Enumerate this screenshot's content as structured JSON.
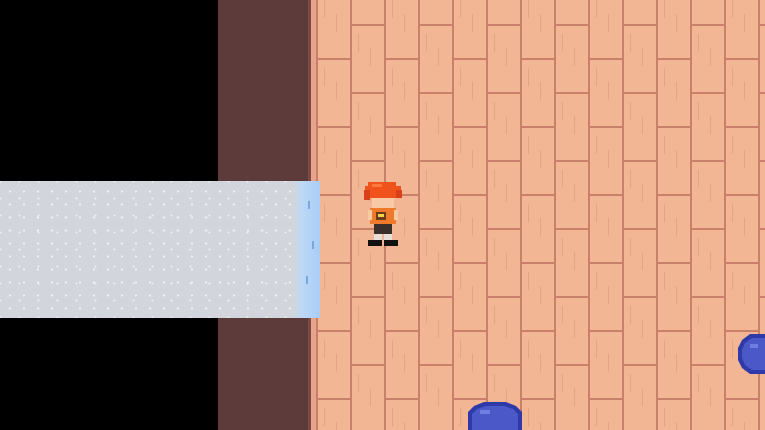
{
  "scene": {
    "type": "top-down pixel-art room",
    "colors": {
      "void": "#000000",
      "wall": "#5c3b3a",
      "floor": "#f2b694",
      "floor_line": "#c9806a",
      "ramp": "#d2d6dc",
      "ramp_edge": "#aacdf5",
      "hair": "#f0521c",
      "shirt": "#f07a2c",
      "enemy": "#4a58c8"
    },
    "entities": [
      {
        "kind": "player",
        "icon": "player-character-icon"
      },
      {
        "kind": "enemy-blob",
        "icon": "blue-slime-icon"
      },
      {
        "kind": "enemy-blob",
        "icon": "blue-slime-icon"
      }
    ]
  }
}
